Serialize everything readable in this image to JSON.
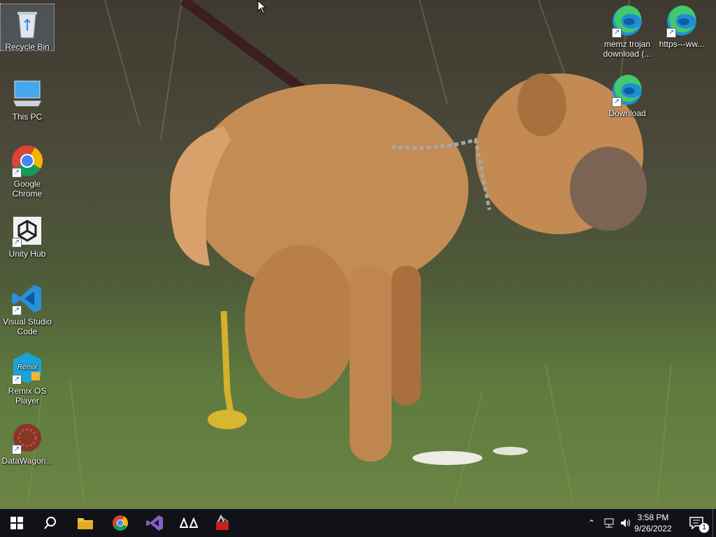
{
  "desktop": {
    "icons_left": [
      {
        "label": "Recycle Bin",
        "icon": "recycle-bin-icon"
      },
      {
        "label": "This PC",
        "icon": "this-pc-icon"
      },
      {
        "label": "Google Chrome",
        "icon": "chrome-icon"
      },
      {
        "label": "Unity Hub",
        "icon": "unity-hub-icon"
      },
      {
        "label": "Visual Studio Code",
        "icon": "vscode-icon"
      },
      {
        "label": "Remix OS Player",
        "icon": "remix-os-icon"
      },
      {
        "label": "DataWagon...",
        "icon": "datawagon-icon"
      }
    ],
    "icons_right": [
      {
        "label": "memz trojan download (...",
        "icon": "edge-icon"
      },
      {
        "label": "https---ww...",
        "icon": "edge-icon"
      },
      {
        "label": "Download",
        "icon": "edge-icon"
      }
    ]
  },
  "taskbar": {
    "start": "windows-start-icon",
    "search": "search-icon",
    "apps": [
      "file-explorer-icon",
      "chrome-icon",
      "visual-studio-icon",
      "unity-hub-icon",
      "memz-icon"
    ],
    "clock": {
      "time": "3:58 PM",
      "date": "9/26/2022"
    },
    "notifications_count": "1"
  },
  "colors": {
    "taskbar": "#101218",
    "edge_blue": "#1f8dd6",
    "edge_green": "#41c96b",
    "vscode_blue": "#2a8fdc"
  }
}
